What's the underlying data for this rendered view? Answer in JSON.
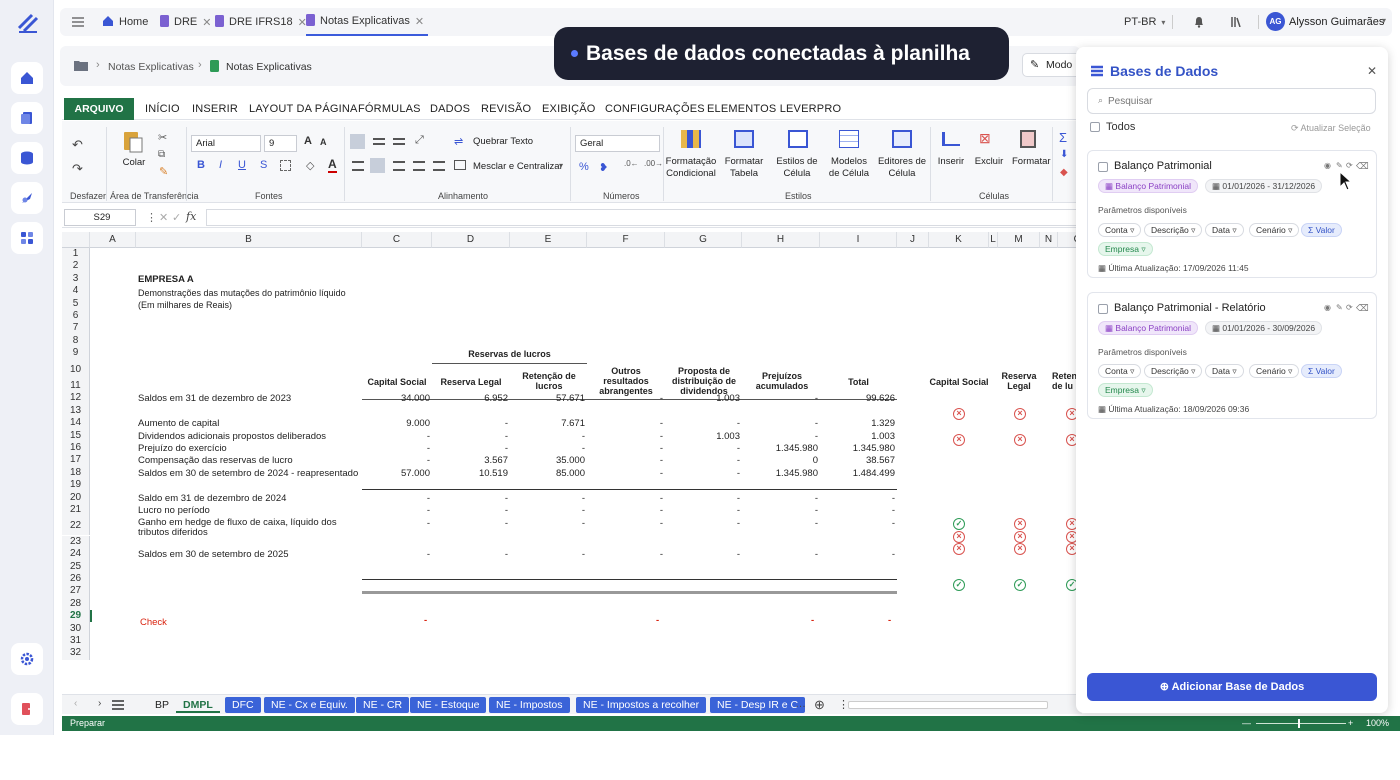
{
  "topbar": {
    "tabs": [
      {
        "label": "Home"
      },
      {
        "label": "DRE"
      },
      {
        "label": "DRE IFRS18"
      },
      {
        "label": "Notas Explicativas"
      }
    ],
    "language": "PT-BR",
    "user_initials": "AG",
    "user_name": "Alysson Guimarães"
  },
  "breadcrumb": {
    "items": [
      "Notas Explicativas",
      "Notas Explicativas"
    ],
    "mode_label": "Modo"
  },
  "toast": {
    "text": "Bases de dados conectadas à planilha"
  },
  "ribbon": {
    "file_tab": "ARQUIVO",
    "tabs": [
      "INÍCIO",
      "INSERIR",
      "LAYOUT DA PÁGINA",
      "FÓRMULAS",
      "DADOS",
      "REVISÃO",
      "EXIBIÇÃO",
      "CONFIGURAÇÕES",
      "ELEMENTOS LEVERPRO"
    ],
    "paste_label": "Colar",
    "font_name": "Arial",
    "font_size": "9",
    "wrap_text": "Quebrar Texto",
    "merge_center": "Mesclar e Centralizar",
    "number_format": "Geral",
    "cond_format": [
      "Formatação",
      "Condicional"
    ],
    "format_table": [
      "Formatar",
      "Tabela"
    ],
    "cell_styles": [
      "Estilos de",
      "Célula"
    ],
    "cell_models": [
      "Modelos",
      "de Célula"
    ],
    "cell_editors": [
      "Editores de",
      "Célula"
    ],
    "insert": "Inserir",
    "delete": "Excluir",
    "format": "Formatar",
    "groups": {
      "undo": "Desfazer",
      "clipboard": "Área de Transferência",
      "fonts": "Fontes",
      "alignment": "Alinhamento",
      "numbers": "Números",
      "styles": "Estilos",
      "cells": "Células"
    }
  },
  "formula_bar": {
    "name_box": "S29",
    "fx": "fx",
    "formula": ""
  },
  "grid": {
    "columns": [
      "A",
      "B",
      "C",
      "D",
      "E",
      "F",
      "G",
      "H",
      "I",
      "J",
      "K",
      "L",
      "M",
      "N",
      "O"
    ],
    "rows": [
      "1",
      "2",
      "3",
      "4",
      "5",
      "6",
      "7",
      "8",
      "9",
      "10",
      "11",
      "12",
      "13",
      "14",
      "15",
      "16",
      "17",
      "18",
      "19",
      "20",
      "21",
      "22",
      "23",
      "24",
      "25",
      "26",
      "27",
      "28",
      "29",
      "30",
      "31",
      "32"
    ],
    "company": "EMPRESA A",
    "subtitle1": "Demonstrações das mutações do patrimônio líquido",
    "subtitle2": "(Em milhares de Reais)",
    "group_header": "Reservas de lucros",
    "headers": {
      "capital": "Capital Social",
      "legal": "Reserva Legal",
      "retencao": "Retenção de lucros",
      "outros": "Outros resultados abrangentes",
      "proposta": "Proposta de distribuição de dividendos",
      "prejuizos": "Prejuízos acumulados",
      "total": "Total",
      "k": "Capital Social",
      "m": "Reserva Legal",
      "o": "Reten de lu"
    },
    "lines": [
      {
        "row": 12,
        "label": "Saldos em 31 de dezembro de 2023",
        "values": [
          "34.000",
          "6.952",
          "57.671",
          "-",
          "1.003",
          "-",
          "99.626"
        ]
      },
      {
        "row": 14,
        "label": "Aumento de capital",
        "values": [
          "9.000",
          "-",
          "7.671",
          "-",
          "-",
          "-",
          "1.329"
        ]
      },
      {
        "row": 15,
        "label": "Dividendos adicionais propostos deliberados",
        "values": [
          "-",
          "-",
          "-",
          "-",
          "1.003",
          "-",
          "1.003"
        ]
      },
      {
        "row": 16,
        "label": "Prejuízo do exercício",
        "values": [
          "-",
          "-",
          "-",
          "-",
          "-",
          "1.345.980",
          "1.345.980"
        ]
      },
      {
        "row": 17,
        "label": "Compensação das reservas de lucro",
        "values": [
          "-",
          "3.567",
          "35.000",
          "-",
          "-",
          "0",
          "38.567"
        ]
      },
      {
        "row": 18,
        "label": "Saldos em 30 de setembro de 2024 - reapresentado",
        "values": [
          "57.000",
          "10.519",
          "85.000",
          "-",
          "-",
          "1.345.980",
          "1.484.499"
        ]
      },
      {
        "row": 20,
        "label": "Saldo em 31 de dezembro de 2024",
        "values": [
          "-",
          "-",
          "-",
          "-",
          "-",
          "-",
          "-"
        ]
      },
      {
        "row": 21,
        "label": "Lucro no período",
        "values": [
          "-",
          "-",
          "-",
          "-",
          "-",
          "-",
          "-"
        ]
      },
      {
        "row": 22,
        "label": "Ganho em hedge de fluxo de caixa, líquido dos tributos diferidos",
        "values": [
          "-",
          "-",
          "-",
          "-",
          "-",
          "-",
          "-"
        ]
      },
      {
        "row": 24,
        "label": "Saldos em 30 de setembro de 2025",
        "values": [
          "-",
          "-",
          "-",
          "-",
          "-",
          "-",
          "-"
        ]
      }
    ],
    "check_label": "Check",
    "check_values": [
      "-",
      "-",
      "-",
      "-"
    ]
  },
  "sheets": [
    "BP",
    "DMPL",
    "DFC",
    "NE - Cx e Equiv.",
    "NE - CR",
    "NE - Estoque",
    "NE - Impostos",
    "NE - Impostos a recolher",
    "NE - Desp IR e C"
  ],
  "active_sheet": "DMPL",
  "status": {
    "text": "Preparar",
    "zoom": "100%"
  },
  "panel": {
    "title": "Bases de Dados",
    "search_placeholder": "Pesquisar",
    "all_label": "Todos",
    "refresh_label": "Atualizar Seleção",
    "cards": [
      {
        "title": "Balanço Patrimonial",
        "tag": "Balanço Patrimonial",
        "period": "01/01/2026 - 31/12/2026",
        "params_label": "Parâmetros disponíveis",
        "params": [
          "Conta",
          "Descrição",
          "Data",
          "Cenário"
        ],
        "value_param": "Σ Valor",
        "company_param": "Empresa",
        "updated": "Última Atualização: 17/09/2026 11:45"
      },
      {
        "title": "Balanço Patrimonial - Relatório",
        "tag": "Balanço Patrimonial",
        "period": "01/01/2026 - 30/09/2026",
        "params_label": "Parâmetros disponíveis",
        "params": [
          "Conta",
          "Descrição",
          "Data",
          "Cenário"
        ],
        "value_param": "Σ Valor",
        "company_param": "Empresa",
        "updated": "Última Atualização: 18/09/2026 09:36"
      }
    ],
    "add_button": "Adicionar Base de Dados"
  },
  "colors": {
    "brand_green": "#217346",
    "accent_blue": "#3a56d4",
    "error_red": "#d9534f",
    "ok_green": "#2e9b57"
  }
}
